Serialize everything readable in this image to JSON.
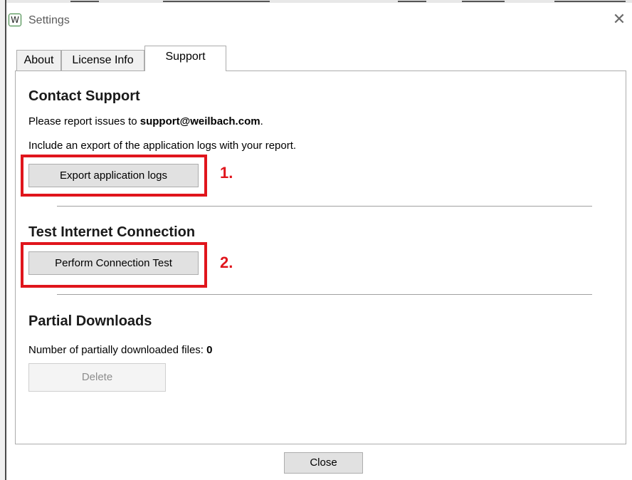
{
  "window": {
    "app_icon": "W",
    "title": "Settings",
    "close_glyph": "✕"
  },
  "tabs": [
    {
      "label": "About",
      "selected": false
    },
    {
      "label": "License Info",
      "selected": false
    },
    {
      "label": "Support",
      "selected": true
    }
  ],
  "contact": {
    "heading": "Contact Support",
    "report_prefix": "Please report issues to ",
    "email": "support@weilbach.com",
    "report_suffix": ".",
    "include_text": "Include an export of the application logs with your report.",
    "export_button": "Export application logs",
    "annotation": "1."
  },
  "connection": {
    "heading": "Test Internet Connection",
    "test_button": "Perform Connection Test",
    "annotation": "2."
  },
  "partial": {
    "heading": "Partial Downloads",
    "count_label": "Number of partially downloaded files: ",
    "count_value": "0",
    "delete_button": "Delete"
  },
  "footer": {
    "close_button": "Close"
  },
  "colors": {
    "annotation_red": "#e0151c",
    "icon_border_green": "#2e7d32"
  }
}
